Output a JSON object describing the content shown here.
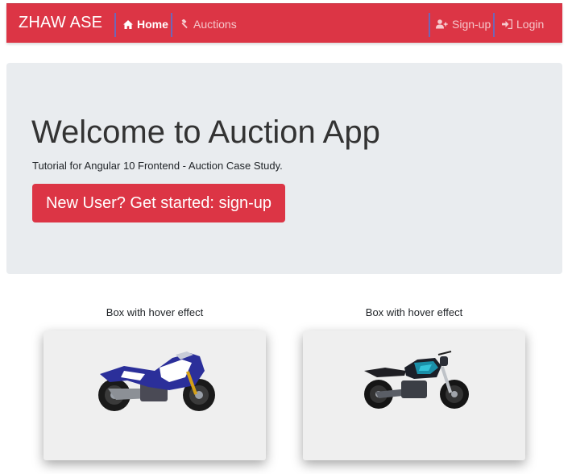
{
  "navbar": {
    "brand": "ZHAW ASE",
    "links": [
      {
        "label": "Home",
        "icon": "home-icon",
        "active": true
      },
      {
        "label": "Auctions",
        "icon": "gavel-icon",
        "active": false
      },
      {
        "label": "Sign-up",
        "icon": "user-plus-icon",
        "active": false
      },
      {
        "label": "Login",
        "icon": "sign-in-icon",
        "active": false
      }
    ],
    "colors": {
      "background": "#dc3545",
      "separator": "#6f66b8"
    }
  },
  "jumbotron": {
    "title": "Welcome to Auction App",
    "lead": "Tutorial for Angular 10 Frontend - Auction Case Study.",
    "button_label": "New User? Get started: sign-up",
    "background": "#e9ecef"
  },
  "boxes": [
    {
      "caption": "Box with hover effect",
      "image": "motorcycle-sport-blue"
    },
    {
      "caption": "Box with hover effect",
      "image": "motorcycle-naked-teal"
    }
  ],
  "colors": {
    "accent": "#dc3545"
  }
}
